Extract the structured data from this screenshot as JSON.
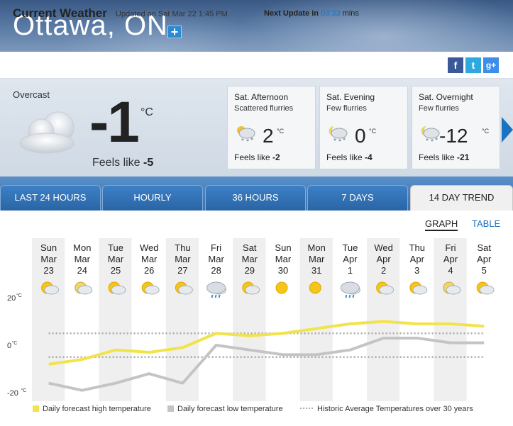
{
  "header": {
    "city": "Ottawa, ON",
    "add_label": "+"
  },
  "current_bar": {
    "title": "Current Weather",
    "updated": "Updated on Sat Mar 22 1:45 PM",
    "next_label": "Next Update in",
    "next_time": "03:33",
    "next_unit": "mins",
    "social": {
      "facebook": "f",
      "twitter": "t",
      "googleplus": "g+"
    }
  },
  "current": {
    "condition": "Overcast",
    "temp": "-1",
    "unit": "°C",
    "feels_label": "Feels like",
    "feels_value": "-5",
    "icon": "overcast-cloud-icon"
  },
  "short_forecast": [
    {
      "title": "Sat. Afternoon",
      "summary": "Scattered flurries",
      "temp": "2",
      "unit": "°C",
      "feels_label": "Feels like",
      "feels_value": "-2",
      "icon": "flurries-sun-icon"
    },
    {
      "title": "Sat. Evening",
      "summary": "Few flurries",
      "temp": "0",
      "unit": "°C",
      "feels_label": "Feels like",
      "feels_value": "-4",
      "icon": "flurries-moon-icon"
    },
    {
      "title": "Sat. Overnight",
      "summary": "Few flurries",
      "temp": "-12",
      "unit": "°C",
      "feels_label": "Feels like",
      "feels_value": "-21",
      "icon": "flurries-moon-icon"
    }
  ],
  "tabs": [
    {
      "label": "LAST 24 HOURS",
      "active": false
    },
    {
      "label": "HOURLY",
      "active": false
    },
    {
      "label": "36 HOURS",
      "active": false
    },
    {
      "label": "7 DAYS",
      "active": false
    },
    {
      "label": "14 DAY TREND",
      "active": true
    }
  ],
  "view_links": {
    "graph": "GRAPH",
    "table": "TABLE"
  },
  "chart_data": {
    "type": "line",
    "categories": [
      "Sun Mar 23",
      "Mon Mar 24",
      "Tue Mar 25",
      "Wed Mar 26",
      "Thu Mar 27",
      "Fri Mar 28",
      "Sat Mar 29",
      "Sun Mar 30",
      "Mon Mar 31",
      "Tue Apr 1",
      "Wed Apr 2",
      "Thu Apr 3",
      "Fri Apr 4",
      "Sat Apr 5"
    ],
    "days": [
      {
        "dow": "Sun",
        "mon": "Mar",
        "day": "23",
        "icon": "sun-cloud-icon"
      },
      {
        "dow": "Mon",
        "mon": "Mar",
        "day": "24",
        "icon": "moon-cloud-icon"
      },
      {
        "dow": "Tue",
        "mon": "Mar",
        "day": "25",
        "icon": "sun-cloud-icon"
      },
      {
        "dow": "Wed",
        "mon": "Mar",
        "day": "26",
        "icon": "sun-cloud-icon"
      },
      {
        "dow": "Thu",
        "mon": "Mar",
        "day": "27",
        "icon": "sun-flurries-icon"
      },
      {
        "dow": "Fri",
        "mon": "Mar",
        "day": "28",
        "icon": "rain-cloud-icon"
      },
      {
        "dow": "Sat",
        "mon": "Mar",
        "day": "29",
        "icon": "sun-cloud-icon"
      },
      {
        "dow": "Sun",
        "mon": "Mar",
        "day": "30",
        "icon": "sun-icon"
      },
      {
        "dow": "Mon",
        "mon": "Mar",
        "day": "31",
        "icon": "sun-icon"
      },
      {
        "dow": "Tue",
        "mon": "Apr",
        "day": "1",
        "icon": "rain-cloud-icon"
      },
      {
        "dow": "Wed",
        "mon": "Apr",
        "day": "2",
        "icon": "sun-cloud-icon"
      },
      {
        "dow": "Thu",
        "mon": "Apr",
        "day": "3",
        "icon": "sun-cloud-icon"
      },
      {
        "dow": "Fri",
        "mon": "Apr",
        "day": "4",
        "icon": "moon-cloud-icon"
      },
      {
        "dow": "Sat",
        "mon": "Apr",
        "day": "5",
        "icon": "sun-flurries-icon"
      }
    ],
    "series": [
      {
        "name": "Daily forecast high temperature",
        "color": "#f2e34a",
        "values": [
          -8,
          -6,
          -2,
          -3,
          -1,
          5,
          4,
          5,
          7,
          9,
          10,
          9,
          9,
          8
        ]
      },
      {
        "name": "Daily forecast low temperature",
        "color": "#c4c4c4",
        "values": [
          -16,
          -19,
          -16,
          -12,
          -16,
          0,
          -2,
          -4,
          -4,
          -2,
          3,
          3,
          1,
          1
        ]
      },
      {
        "name": "Historic Average Temperatures over 30 years",
        "color": "#aaaaaa",
        "style": "dotted",
        "values_high": [
          5,
          5,
          5,
          5,
          5,
          5,
          5,
          5,
          5,
          5,
          5,
          5,
          5,
          5
        ],
        "values_low": [
          -5,
          -5,
          -5,
          -5,
          -5,
          -5,
          -5,
          -5,
          -5,
          -5,
          -5,
          -5,
          -5,
          -5
        ]
      }
    ],
    "y_ticks": [
      {
        "value": 20,
        "label": "20",
        "unit": "°C"
      },
      {
        "value": 0,
        "label": "0",
        "unit": "°C"
      },
      {
        "value": -20,
        "label": "-20",
        "unit": "°C"
      }
    ],
    "ylim": [
      -20,
      20
    ],
    "legend_position": "bottom"
  }
}
